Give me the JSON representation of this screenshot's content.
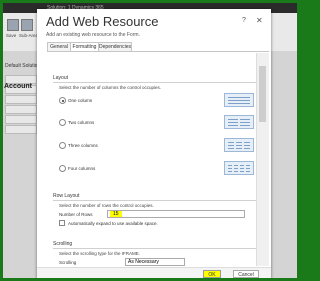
{
  "background": {
    "top_bar_text": "Solution: 1 Dynamics 365",
    "ribbon_labels": [
      "Save",
      "Sub-Area"
    ],
    "left_labels": [
      "Default Solutio",
      "Account"
    ]
  },
  "dialog": {
    "title": "Add Web Resource",
    "subtitle": "Add an existing web resource to the Form.",
    "help_label": "?",
    "close_label": "✕",
    "tabs": [
      {
        "label": "General",
        "active": false
      },
      {
        "label": "Formatting",
        "active": true
      },
      {
        "label": "Dependencies",
        "active": false
      }
    ],
    "layout": {
      "title": "Layout",
      "description": "Select the number of columns the control occupies.",
      "options": [
        {
          "label": "One column",
          "selected": true
        },
        {
          "label": "Two columns",
          "selected": false
        },
        {
          "label": "Three columns",
          "selected": false
        },
        {
          "label": "Four columns",
          "selected": false
        }
      ]
    },
    "rows_layout": {
      "title": "Row Layout",
      "description": "Select the number of rows the control occupies.",
      "rows_label": "Number of Rows",
      "rows_value": "15",
      "auto_expand_label": "Automatically expand to use available space.",
      "auto_expand_checked": false
    },
    "scrolling": {
      "title": "Scrolling",
      "description": "Select the scrolling type for the IFRAME.",
      "label": "Scrolling",
      "value": "As Necessary"
    },
    "ok_label": "OK",
    "cancel_label": "Cancel",
    "highlight_color": "#ffff00"
  }
}
